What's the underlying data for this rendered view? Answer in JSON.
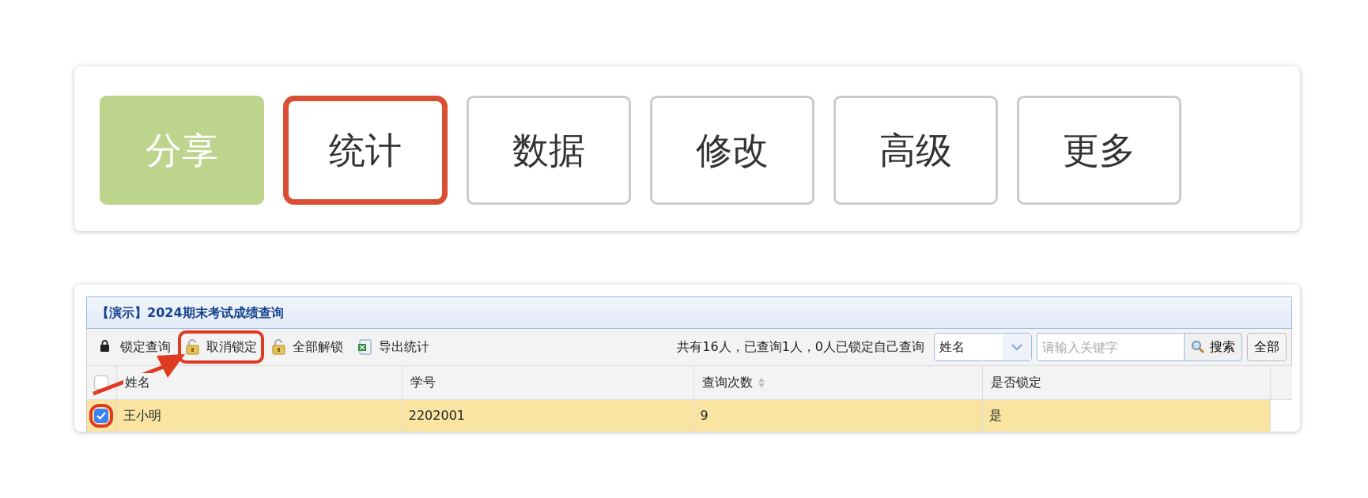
{
  "action_buttons": [
    {
      "label": "分享",
      "selected": true,
      "annotated": false
    },
    {
      "label": "统计",
      "selected": false,
      "annotated": true
    },
    {
      "label": "数据",
      "selected": false,
      "annotated": false
    },
    {
      "label": "修改",
      "selected": false,
      "annotated": false
    },
    {
      "label": "高级",
      "selected": false,
      "annotated": false
    },
    {
      "label": "更多",
      "selected": false,
      "annotated": false
    }
  ],
  "grid": {
    "title": "【演示】2024期末考试成绩查询",
    "toolbar": [
      {
        "label": "锁定查询",
        "kind": "lock",
        "annotated": false
      },
      {
        "label": "取消锁定",
        "kind": "unlock",
        "annotated": true
      },
      {
        "label": "全部解锁",
        "kind": "unlock",
        "annotated": false
      },
      {
        "label": "导出统计",
        "kind": "excel",
        "annotated": false
      }
    ],
    "summary": "共有16人，已查询1人，0人已锁定自己查询",
    "filter_select": {
      "value": "姓名"
    },
    "search": {
      "placeholder": "请输入关键字",
      "button": "搜索"
    },
    "all_button": "全部",
    "columns": [
      {
        "label": "姓名",
        "sortable": false
      },
      {
        "label": "学号",
        "sortable": false
      },
      {
        "label": "查询次数",
        "sortable": true
      },
      {
        "label": "是否锁定",
        "sortable": false
      }
    ],
    "header_checked": false,
    "rows": [
      {
        "cells": [
          "王小明",
          "2202001",
          "9",
          "是"
        ],
        "checked": true,
        "selected": true,
        "annotated": true
      }
    ],
    "arrow": true
  }
}
